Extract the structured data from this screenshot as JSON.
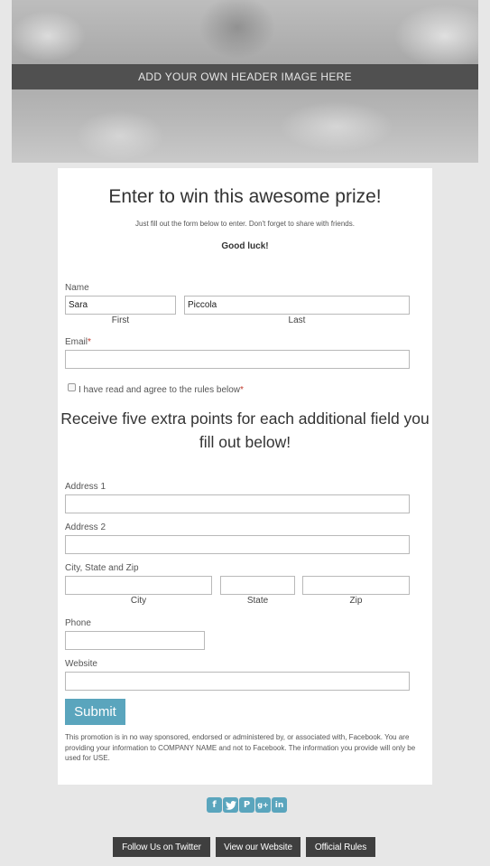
{
  "header": {
    "banner_text": "ADD YOUR OWN HEADER IMAGE HERE"
  },
  "form": {
    "title": "Enter to win this awesome prize!",
    "intro": "Just fill out the form below to enter. Don't forget to share with friends.",
    "good_luck": "Good luck!",
    "name": {
      "label": "Name",
      "first_value": "Sara",
      "last_value": "Piccola",
      "first_sublabel": "First",
      "last_sublabel": "Last"
    },
    "email": {
      "label": "Email",
      "required_mark": "*",
      "value": ""
    },
    "agree": {
      "label": "I have read and agree to the rules below",
      "required_mark": "*",
      "checked": false
    },
    "bonus_heading": "Receive five extra points for each additional field you fill out below!",
    "address1": {
      "label": "Address 1",
      "value": ""
    },
    "address2": {
      "label": "Address 2",
      "value": ""
    },
    "city_state_zip": {
      "label": "City, State and Zip",
      "city_sublabel": "City",
      "state_sublabel": "State",
      "zip_sublabel": "Zip"
    },
    "phone": {
      "label": "Phone",
      "value": ""
    },
    "website": {
      "label": "Website",
      "value": ""
    },
    "submit_label": "Submit",
    "disclaimer": "This promotion is in no way sponsored, endorsed or administered by, or associated with, Facebook. You are providing your information to COMPANY NAME and not to Facebook. The information you provide will only be used for USE."
  },
  "social": {
    "icons": [
      "facebook-icon",
      "twitter-icon",
      "pinterest-icon",
      "google-plus-icon",
      "linkedin-icon"
    ],
    "color": "#5aa5bd"
  },
  "footer": {
    "twitter_label": "Follow Us on Twitter",
    "website_label": "View our Website",
    "rules_label": "Official Rules"
  },
  "colors": {
    "accent": "#5aa5bd",
    "footer_button": "#3f3f3f",
    "background": "#e7e7e7"
  }
}
